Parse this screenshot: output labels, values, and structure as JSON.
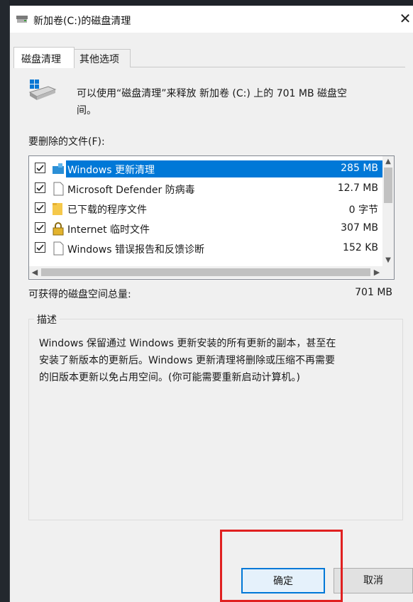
{
  "window": {
    "title": "新加卷(C:)的磁盘清理",
    "close_symbol": "✕"
  },
  "tabs": [
    {
      "label": "磁盘清理",
      "active": true
    },
    {
      "label": "其他选项",
      "active": false
    }
  ],
  "header": {
    "description_line1": "可以使用“磁盘清理”来释放 新加卷 (C:) 上的 701 MB 磁盘空",
    "description_line2": "间。"
  },
  "files_label": "要删除的文件(F):",
  "files": [
    {
      "name": "Windows 更新清理",
      "size": "285 MB",
      "checked": true,
      "selected": true,
      "icon": "windows-update-icon"
    },
    {
      "name": "Microsoft Defender 防病毒",
      "size": "12.7 MB",
      "checked": true,
      "selected": false,
      "icon": "document-icon"
    },
    {
      "name": "已下载的程序文件",
      "size": "0 字节",
      "checked": true,
      "selected": false,
      "icon": "folder-icon"
    },
    {
      "name": "Internet 临时文件",
      "size": "307 MB",
      "checked": true,
      "selected": false,
      "icon": "lock-icon"
    },
    {
      "name": "Windows 错误报告和反馈诊断",
      "size": "152 KB",
      "checked": true,
      "selected": false,
      "icon": "document-icon"
    }
  ],
  "space": {
    "label": "可获得的磁盘空间总量:",
    "value": "701 MB"
  },
  "description": {
    "title": "描述",
    "lines": [
      "Windows 保留通过 Windows 更新安装的所有更新的副本，甚至在",
      "安装了新版本的更新后。Windows 更新清理将删除或压缩不再需要",
      "的旧版本更新以免占用空间。(你可能需要重新启动计算机。)"
    ]
  },
  "buttons": {
    "ok": "确定",
    "cancel": "取消"
  },
  "colors": {
    "selection": "#0078d7",
    "highlight_box": "#e02020"
  }
}
